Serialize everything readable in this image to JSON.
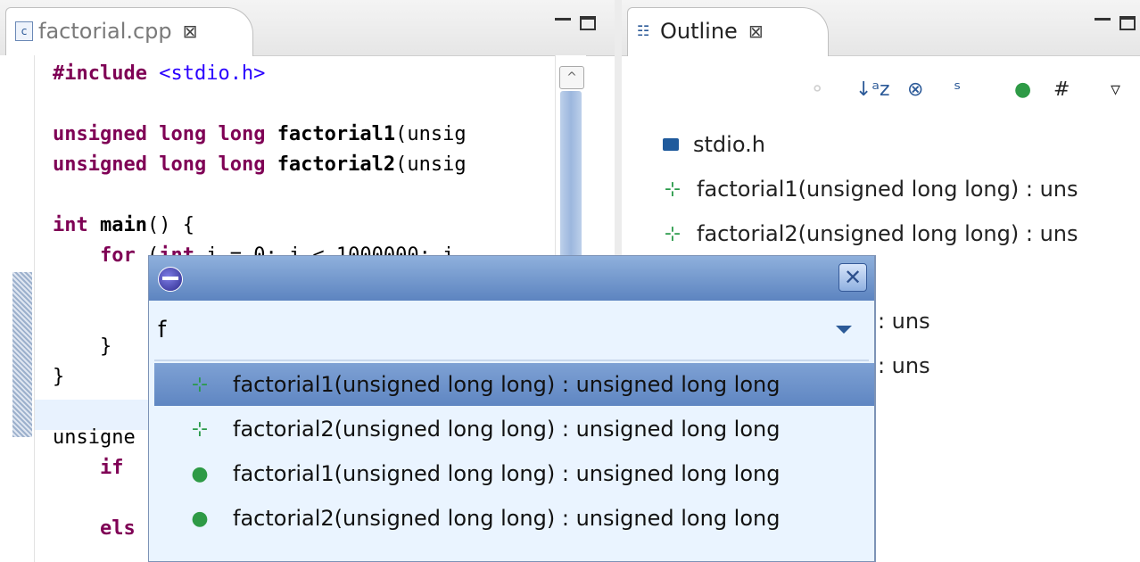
{
  "editor": {
    "tab": {
      "label": "factorial.cpp",
      "close": "⊠",
      "icon": "c-source-file-icon"
    },
    "lines": [
      "#include <stdio.h>",
      "",
      "unsigned long long factorial1(unsig",
      "unsigned long long factorial2(unsig",
      "",
      "int main() {",
      "    for (int i = 0; i < 1000000; i",
      "",
      "",
      "    }",
      "}",
      "",
      "unsigne",
      "    if",
      "",
      "    els"
    ]
  },
  "outline": {
    "tab": {
      "label": "Outline",
      "close": "⊠",
      "icon": "outline-icon"
    },
    "toolbar": [
      {
        "name": "hide-fields-icon",
        "glyph": "⚬"
      },
      {
        "name": "sort-az-icon",
        "glyph": "↓ᵃz"
      },
      {
        "name": "hide-non-public-icon",
        "glyph": "⊗"
      },
      {
        "name": "hide-static-icon",
        "glyph": "ˢ"
      },
      {
        "name": "hide-local-types-icon",
        "glyph": "●"
      },
      {
        "name": "group-includes-icon",
        "glyph": "#"
      },
      {
        "name": "view-menu-icon",
        "glyph": "▿"
      }
    ],
    "items": [
      {
        "label": "stdio.h",
        "icon": "include-icon"
      },
      {
        "label": "factorial1(unsigned long long) : uns",
        "icon": "function-declaration-icon"
      },
      {
        "label": "factorial2(unsigned long long) : uns",
        "icon": "function-declaration-icon"
      },
      {
        "label": "igned long long) : uns",
        "icon": "function-icon"
      },
      {
        "label": "igned long long) : uns",
        "icon": "function-icon"
      }
    ]
  },
  "quick_outline": {
    "filter_value": "f",
    "close": "✕",
    "results": [
      {
        "label": "factorial1(unsigned long long) : unsigned long long",
        "icon": "function-declaration-icon",
        "selected": true
      },
      {
        "label": "factorial2(unsigned long long) : unsigned long long",
        "icon": "function-declaration-icon",
        "selected": false
      },
      {
        "label": "factorial1(unsigned long long) : unsigned long long",
        "icon": "function-icon",
        "selected": false
      },
      {
        "label": "factorial2(unsigned long long) : unsigned long long",
        "icon": "function-icon",
        "selected": false
      }
    ]
  },
  "colors": {
    "keyword": "#7f0055",
    "include_string": "#2a00ff",
    "selection": "#5f86c2",
    "popup_bg": "#eaf4ff"
  }
}
